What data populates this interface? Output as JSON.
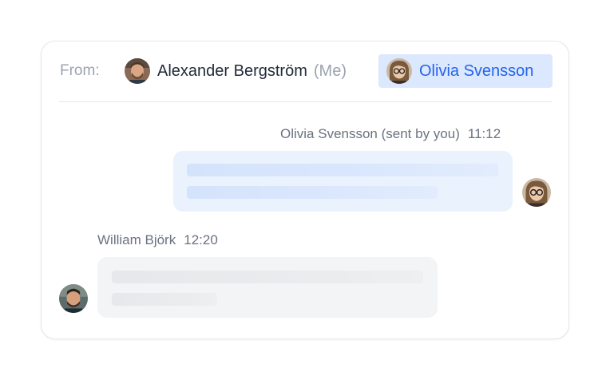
{
  "composer": {
    "from_label": "From:",
    "sender": {
      "name": "Alexander Bergström",
      "suffix": "(Me)",
      "avatar_icon": "avatar-alexander"
    },
    "recipient": {
      "name": "Olivia Svensson",
      "avatar_icon": "avatar-olivia",
      "selected": true
    }
  },
  "messages": [
    {
      "direction": "outgoing",
      "author": "Olivia Svensson (sent by you)",
      "time": "11:12",
      "avatar_icon": "avatar-olivia",
      "text_lines": 2
    },
    {
      "direction": "incoming",
      "author": "William Björk",
      "time": "12:20",
      "avatar_icon": "avatar-william",
      "text_lines": 2
    }
  ],
  "colors": {
    "accent": "#2563eb",
    "accent_bg": "#dbe8fd",
    "outgoing_bubble": "#eaf2fe",
    "incoming_bubble": "#f3f4f6",
    "muted_text": "#9ca3af",
    "body_text": "#1f2937"
  }
}
